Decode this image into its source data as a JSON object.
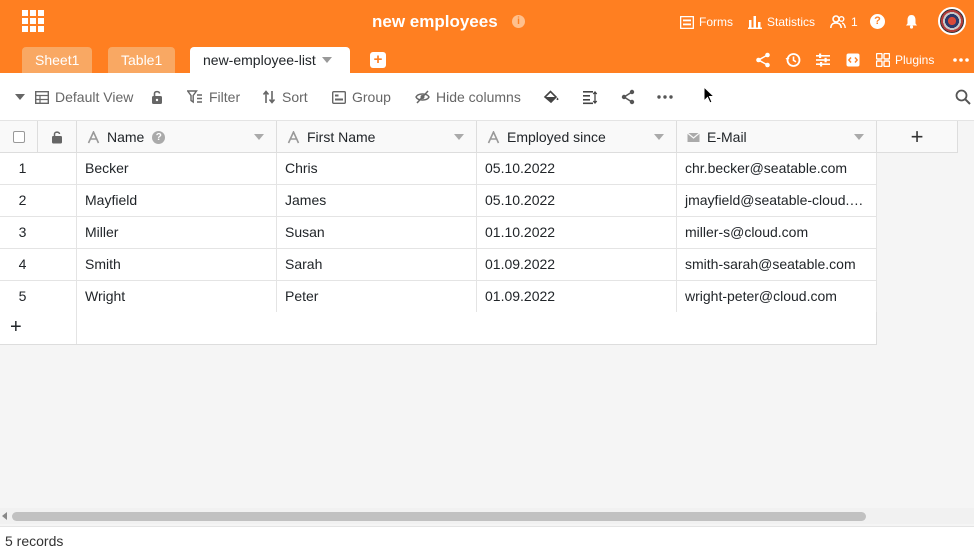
{
  "header": {
    "base_title": "new employees",
    "forms_label": "Forms",
    "statistics_label": "Statistics",
    "collaborators_count": "1",
    "plugins_label": "Plugins",
    "info_glyph": "i",
    "help_glyph": "?",
    "add_tab_glyph": "+"
  },
  "tabs": [
    {
      "label": "Sheet1"
    },
    {
      "label": "Table1"
    },
    {
      "label": "new-employee-list"
    }
  ],
  "toolbar": {
    "view_label": "Default View",
    "filter_label": "Filter",
    "sort_label": "Sort",
    "group_label": "Group",
    "hide_columns_label": "Hide columns"
  },
  "columns": [
    {
      "label": "Name",
      "type_icon": "text-type-icon"
    },
    {
      "label": "First Name",
      "type_icon": "text-type-icon"
    },
    {
      "label": "Employed since",
      "type_icon": "text-type-icon"
    },
    {
      "label": "E-Mail",
      "type_icon": "email-type-icon"
    }
  ],
  "rows": [
    {
      "index": "1",
      "name": "Becker",
      "first_name": "Chris",
      "employed_since": "05.10.2022",
      "email": "chr.becker@seatable.com"
    },
    {
      "index": "2",
      "name": "Mayfield",
      "first_name": "James",
      "employed_since": "05.10.2022",
      "email": "jmayfield@seatable-cloud.…"
    },
    {
      "index": "3",
      "name": "Miller",
      "first_name": "Susan",
      "employed_since": "01.10.2022",
      "email": "miller-s@cloud.com"
    },
    {
      "index": "4",
      "name": "Smith",
      "first_name": "Sarah",
      "employed_since": "01.09.2022",
      "email": "smith-sarah@seatable.com"
    },
    {
      "index": "5",
      "name": "Wright",
      "first_name": "Peter",
      "employed_since": "01.09.2022",
      "email": "wright-peter@cloud.com"
    }
  ],
  "grid": {
    "add_row_glyph": "+",
    "add_column_glyph": "+"
  },
  "footer": {
    "record_count": "5 records"
  },
  "colors": {
    "brand": "#ff7f21"
  }
}
